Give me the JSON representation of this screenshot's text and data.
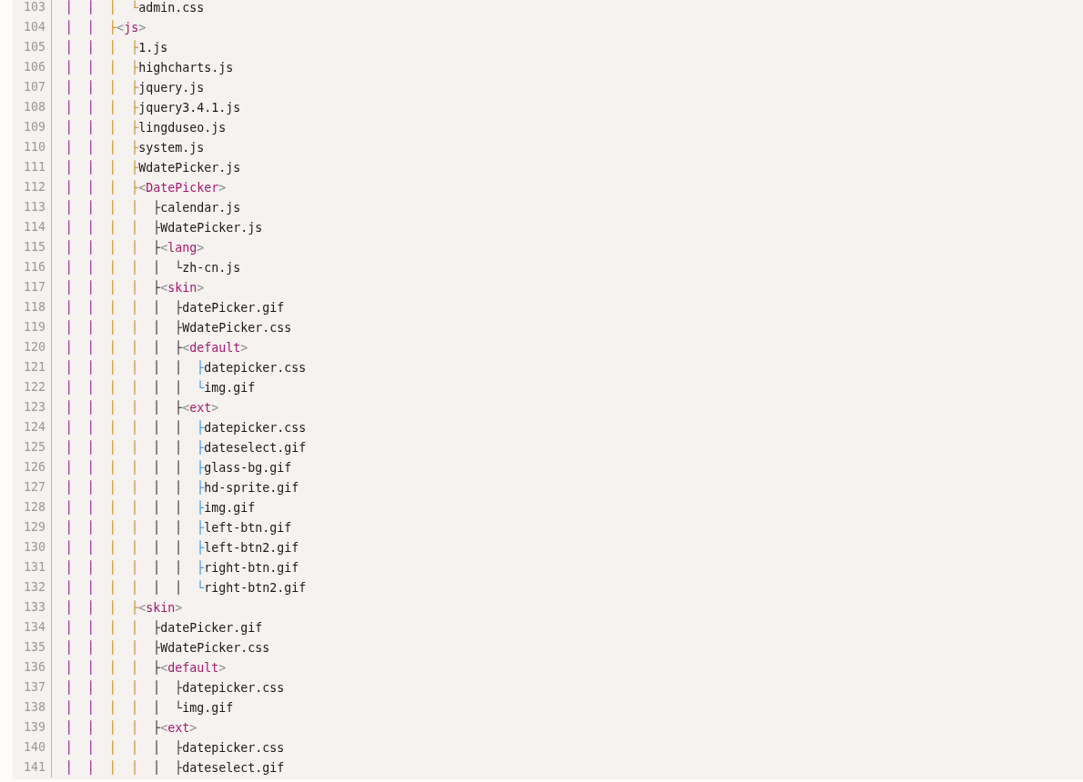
{
  "editor": {
    "lines": [
      {
        "number": "103",
        "prefix": "│  │  │  └",
        "name": "admin.css",
        "kind": "file"
      },
      {
        "number": "104",
        "prefix": "│  │  ├",
        "name": "<js>",
        "kind": "folder"
      },
      {
        "number": "105",
        "prefix": "│  │  │  ├",
        "name": "1.js",
        "kind": "file"
      },
      {
        "number": "106",
        "prefix": "│  │  │  ├",
        "name": "highcharts.js",
        "kind": "file"
      },
      {
        "number": "107",
        "prefix": "│  │  │  ├",
        "name": "jquery.js",
        "kind": "file"
      },
      {
        "number": "108",
        "prefix": "│  │  │  ├",
        "name": "jquery3.4.1.js",
        "kind": "file"
      },
      {
        "number": "109",
        "prefix": "│  │  │  ├",
        "name": "lingduseo.js",
        "kind": "file"
      },
      {
        "number": "110",
        "prefix": "│  │  │  ├",
        "name": "system.js",
        "kind": "file"
      },
      {
        "number": "111",
        "prefix": "│  │  │  ├",
        "name": "WdatePicker.js",
        "kind": "file"
      },
      {
        "number": "112",
        "prefix": "│  │  │  ├",
        "name": "<DatePicker>",
        "kind": "folder"
      },
      {
        "number": "113",
        "prefix": "│  │  │  │  ├",
        "name": "calendar.js",
        "kind": "file"
      },
      {
        "number": "114",
        "prefix": "│  │  │  │  ├",
        "name": "WdatePicker.js",
        "kind": "file"
      },
      {
        "number": "115",
        "prefix": "│  │  │  │  ├",
        "name": "<lang>",
        "kind": "folder"
      },
      {
        "number": "116",
        "prefix": "│  │  │  │  │  └",
        "name": "zh-cn.js",
        "kind": "file"
      },
      {
        "number": "117",
        "prefix": "│  │  │  │  ├",
        "name": "<skin>",
        "kind": "folder"
      },
      {
        "number": "118",
        "prefix": "│  │  │  │  │  ├",
        "name": "datePicker.gif",
        "kind": "file"
      },
      {
        "number": "119",
        "prefix": "│  │  │  │  │  ├",
        "name": "WdatePicker.css",
        "kind": "file"
      },
      {
        "number": "120",
        "prefix": "│  │  │  │  │  ├",
        "name": "<default>",
        "kind": "folder"
      },
      {
        "number": "121",
        "prefix": "│  │  │  │  │  │  ├",
        "name": "datepicker.css",
        "kind": "file"
      },
      {
        "number": "122",
        "prefix": "│  │  │  │  │  │  └",
        "name": "img.gif",
        "kind": "file"
      },
      {
        "number": "123",
        "prefix": "│  │  │  │  │  ├",
        "name": "<ext>",
        "kind": "folder"
      },
      {
        "number": "124",
        "prefix": "│  │  │  │  │  │  ├",
        "name": "datepicker.css",
        "kind": "file"
      },
      {
        "number": "125",
        "prefix": "│  │  │  │  │  │  ├",
        "name": "dateselect.gif",
        "kind": "file"
      },
      {
        "number": "126",
        "prefix": "│  │  │  │  │  │  ├",
        "name": "glass-bg.gif",
        "kind": "file"
      },
      {
        "number": "127",
        "prefix": "│  │  │  │  │  │  ├",
        "name": "hd-sprite.gif",
        "kind": "file"
      },
      {
        "number": "128",
        "prefix": "│  │  │  │  │  │  ├",
        "name": "img.gif",
        "kind": "file"
      },
      {
        "number": "129",
        "prefix": "│  │  │  │  │  │  ├",
        "name": "left-btn.gif",
        "kind": "file"
      },
      {
        "number": "130",
        "prefix": "│  │  │  │  │  │  ├",
        "name": "left-btn2.gif",
        "kind": "file"
      },
      {
        "number": "131",
        "prefix": "│  │  │  │  │  │  ├",
        "name": "right-btn.gif",
        "kind": "file"
      },
      {
        "number": "132",
        "prefix": "│  │  │  │  │  │  └",
        "name": "right-btn2.gif",
        "kind": "file"
      },
      {
        "number": "133",
        "prefix": "│  │  │  ├",
        "name": "<skin>",
        "kind": "folder"
      },
      {
        "number": "134",
        "prefix": "│  │  │  │  ├",
        "name": "datePicker.gif",
        "kind": "file"
      },
      {
        "number": "135",
        "prefix": "│  │  │  │  ├",
        "name": "WdatePicker.css",
        "kind": "file"
      },
      {
        "number": "136",
        "prefix": "│  │  │  │  ├",
        "name": "<default>",
        "kind": "folder"
      },
      {
        "number": "137",
        "prefix": "│  │  │  │  │  ├",
        "name": "datepicker.css",
        "kind": "file"
      },
      {
        "number": "138",
        "prefix": "│  │  │  │  │  └",
        "name": "img.gif",
        "kind": "file"
      },
      {
        "number": "139",
        "prefix": "│  │  │  │  ├",
        "name": "<ext>",
        "kind": "folder"
      },
      {
        "number": "140",
        "prefix": "│  │  │  │  │  ├",
        "name": "datepicker.css",
        "kind": "file"
      },
      {
        "number": "141",
        "prefix": "│  │  │  │  │  ├",
        "name": "dateselect.gif",
        "kind": "file"
      }
    ]
  }
}
